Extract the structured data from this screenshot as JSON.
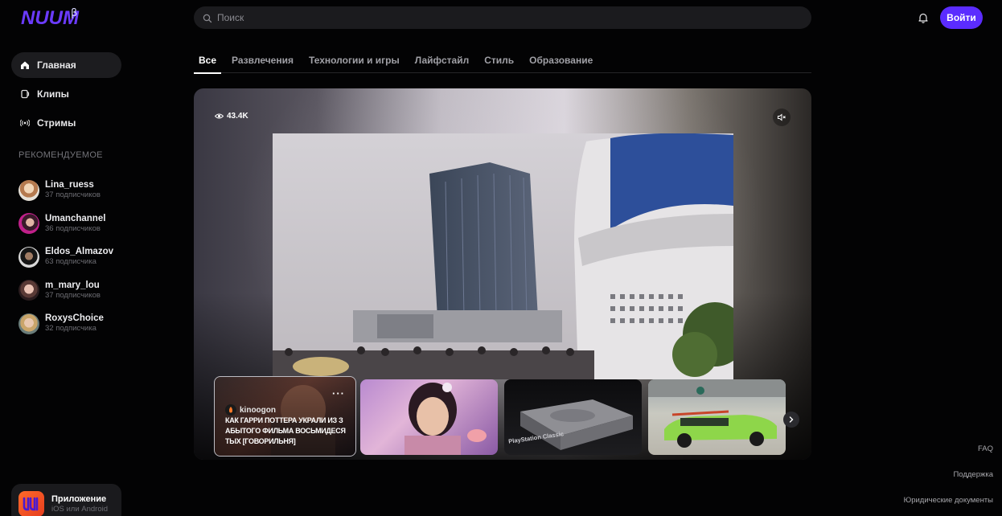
{
  "brand": {
    "logo_text": "NUUM",
    "beta": "β"
  },
  "search": {
    "placeholder": "Поиск"
  },
  "header": {
    "login_label": "Войти"
  },
  "nav": {
    "items": [
      {
        "label": "Главная",
        "icon": "home-icon",
        "active": true
      },
      {
        "label": "Клипы",
        "icon": "clips-icon",
        "active": false
      },
      {
        "label": "Стримы",
        "icon": "broadcast-icon",
        "active": false
      }
    ]
  },
  "recommended": {
    "title": "РЕКОМЕНДУЕМОЕ",
    "channels": [
      {
        "name": "Lina_ruess",
        "subs": "37 подписчиков"
      },
      {
        "name": "Umanchannel",
        "subs": "36 подписчиков"
      },
      {
        "name": "Eldos_Almazov",
        "subs": "63 подписчика"
      },
      {
        "name": "m_mary_lou",
        "subs": "37 подписчиков"
      },
      {
        "name": "RoxysChoice",
        "subs": "32 подписчика"
      }
    ]
  },
  "app_promo": {
    "title": "Приложение",
    "subtitle": "iOS или Android"
  },
  "tabs": [
    {
      "label": "Все",
      "active": true
    },
    {
      "label": "Развлечения",
      "active": false
    },
    {
      "label": "Технологии и игры",
      "active": false
    },
    {
      "label": "Лайфстайл",
      "active": false
    },
    {
      "label": "Стиль",
      "active": false
    },
    {
      "label": "Образование",
      "active": false
    }
  ],
  "hero": {
    "views": "43.4K",
    "cards": [
      {
        "author": "kinoogon",
        "title": "КАК ГАРРИ ПОТТЕРА УКРАЛИ ИЗ З АБЫТОГО ФИЛЬМА ВОСЬМИДЕСЯ ТЫХ [ГОВОРИЛЬНЯ]",
        "more": "···"
      },
      {
        "author": "",
        "title": ""
      },
      {
        "author": "",
        "title": "",
        "caption": "PlayStation Classic"
      },
      {
        "author": "",
        "title": ""
      }
    ]
  },
  "footer": {
    "faq": "FAQ",
    "support": "Поддержка",
    "legal": "Юридические документы"
  },
  "colors": {
    "accent": "#5b2cff",
    "background": "#030304",
    "logo": "#6b3bff"
  }
}
